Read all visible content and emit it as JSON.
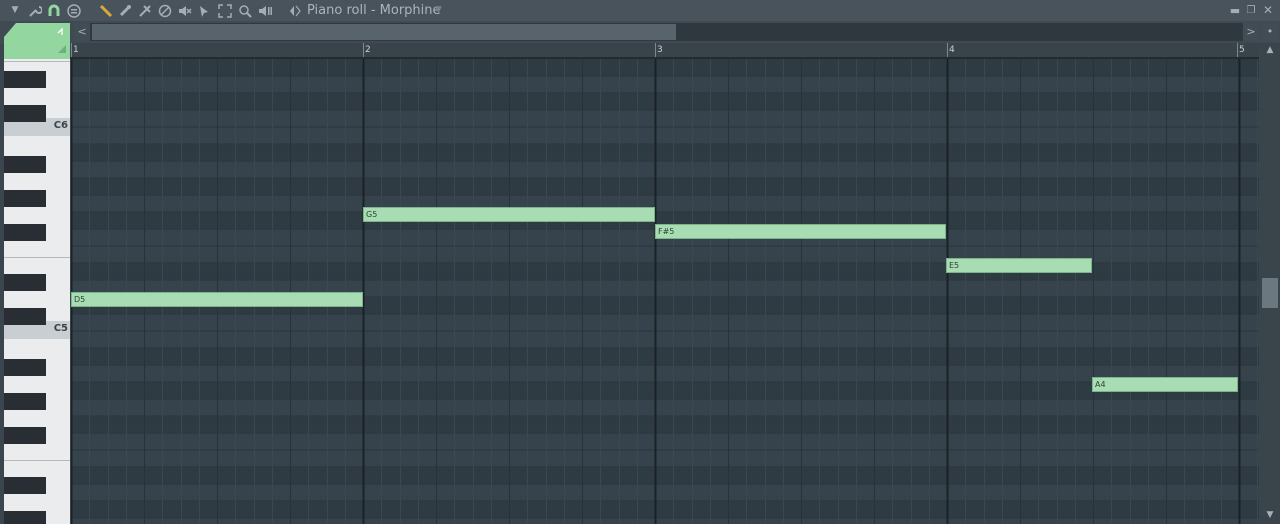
{
  "titlebar": {
    "title": "Piano roll - Morphine",
    "icons": [
      "menu-arrow-icon",
      "wrench-icon",
      "magnet-icon",
      "stamp-icon",
      "pencil-icon",
      "paintbrush-icon",
      "delete-icon",
      "mute-icon",
      "slice-icon",
      "select-icon",
      "zoom-icon",
      "playback-icon",
      "arrow-icon"
    ],
    "window_controls": [
      "minimize",
      "restore",
      "close"
    ]
  },
  "ruler": {
    "bars": [
      "1",
      "2",
      "3",
      "4",
      "5"
    ]
  },
  "keyboard": {
    "labels": [
      "C6",
      "C5"
    ]
  },
  "notes": [
    {
      "name": "D5"
    },
    {
      "name": "G5"
    },
    {
      "name": "F#5"
    },
    {
      "name": "E5"
    },
    {
      "name": "A4"
    }
  ],
  "scroll": {
    "left": "<",
    "right": ">",
    "up": "▲",
    "down": "▼"
  },
  "colors": {
    "note_fill": "#a8ddb3",
    "grid_bg": "#34414a",
    "accent": "#93d6a0"
  }
}
